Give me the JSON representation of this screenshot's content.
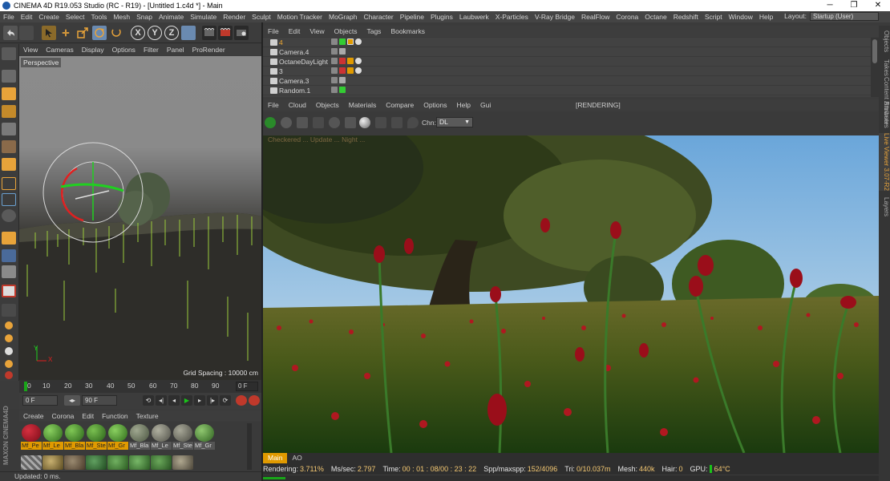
{
  "window": {
    "title": "CINEMA 4D R19.053 Studio (RC - R19) - [Untitled 1.c4d *] - Main",
    "controls": [
      "─",
      "❐",
      "✕"
    ]
  },
  "menubar": {
    "items": [
      "File",
      "Edit",
      "Create",
      "Select",
      "Tools",
      "Mesh",
      "Snap",
      "Animate",
      "Simulate",
      "Render",
      "Sculpt",
      "Motion Tracker",
      "MoGraph",
      "Character",
      "Pipeline",
      "Plugins",
      "Laubwerk",
      "X-Particles",
      "V-Ray Bridge",
      "RealFlow",
      "Corona",
      "Octane",
      "Redshift",
      "Script",
      "Window",
      "Help"
    ],
    "layout_label": "Layout:",
    "layout_value": "Startup (User)"
  },
  "toolbar": {
    "axis_x": "X",
    "axis_y": "Y",
    "axis_z": "Z"
  },
  "viewport": {
    "menu": [
      "View",
      "Cameras",
      "Display",
      "Options",
      "Filter",
      "Panel",
      "ProRender"
    ],
    "label": "Perspective",
    "grid_spacing": "Grid Spacing : 10000 cm",
    "axis_y": "Y",
    "axis_x": "X"
  },
  "timeline": {
    "ticks": [
      "0",
      "10",
      "20",
      "30",
      "40",
      "50",
      "60",
      "70",
      "80",
      "90"
    ],
    "current_frame": "0 F"
  },
  "playback": {
    "start": "0 F",
    "end": "90 F"
  },
  "materials": {
    "menu": [
      "Create",
      "Corona",
      "Edit",
      "Function",
      "Texture"
    ],
    "row1": [
      {
        "label": "Mf_Pe",
        "color": "#8a0f1a",
        "tag": "orange"
      },
      {
        "label": "Mf_Le",
        "color": "#4a8a2a",
        "tag": "orange"
      },
      {
        "label": "Mf_Bla",
        "color": "#3f7f27",
        "tag": "orange"
      },
      {
        "label": "Mf_Ste",
        "color": "#3a7a25",
        "tag": "orange"
      },
      {
        "label": "Mf_Gr",
        "color": "#4a8a2a",
        "tag": "orange"
      },
      {
        "label": "Mf_Bla",
        "color": "#6b7a5a",
        "tag": "gray"
      },
      {
        "label": "Mf_Le",
        "color": "#7a7a6a",
        "tag": "gray"
      },
      {
        "label": "Mf_Ste",
        "color": "#6f6f60",
        "tag": "gray"
      },
      {
        "label": "Mf_Gr",
        "color": "#4f8a35",
        "tag": "gray"
      }
    ]
  },
  "maxon": "MAXON CINEMA4D",
  "status": "Updated: 0 ms.",
  "objects": {
    "menu": [
      "File",
      "Edit",
      "View",
      "Objects",
      "Tags",
      "Bookmarks"
    ],
    "rows": [
      {
        "name": "4",
        "highlight": true
      },
      {
        "name": "Camera.4",
        "highlight": false
      },
      {
        "name": "OctaneDayLight",
        "highlight": false
      },
      {
        "name": "3",
        "highlight": false
      },
      {
        "name": "Camera.3",
        "highlight": false
      },
      {
        "name": "Random.1",
        "highlight": false
      }
    ]
  },
  "liveviewer": {
    "menu": [
      "File",
      "Cloud",
      "Objects",
      "Materials",
      "Compare",
      "Options",
      "Help",
      "Gui"
    ],
    "status": "[RENDERING]",
    "channel_label": "Chn:",
    "channel_value": "DL",
    "overlay_text": "Checkered ... Update ... Night ..."
  },
  "render_tabs": [
    "Main",
    "AO"
  ],
  "render_info": {
    "rendering_label": "Rendering:",
    "rendering_value": "3.711%",
    "ms_label": "Ms/sec:",
    "ms_value": "2.797",
    "time_label": "Time:",
    "time_value": "00 : 01 : 08/00 : 23 : 22",
    "spp_label": "Spp/maxspp:",
    "spp_value": "152/4096",
    "tri_label": "Tri:",
    "tri_value": "0/10.037m",
    "mesh_label": "Mesh:",
    "mesh_value": "440k",
    "hair_label": "Hair:",
    "hair_value": "0",
    "gpu_label": "GPU:",
    "gpu_value": "64°C",
    "progress": 0.037
  },
  "right_tabs": [
    "Objects",
    "Takes",
    "Content Browser",
    "Attributes",
    "Live Viewer 3.07-R2",
    "Layers"
  ]
}
